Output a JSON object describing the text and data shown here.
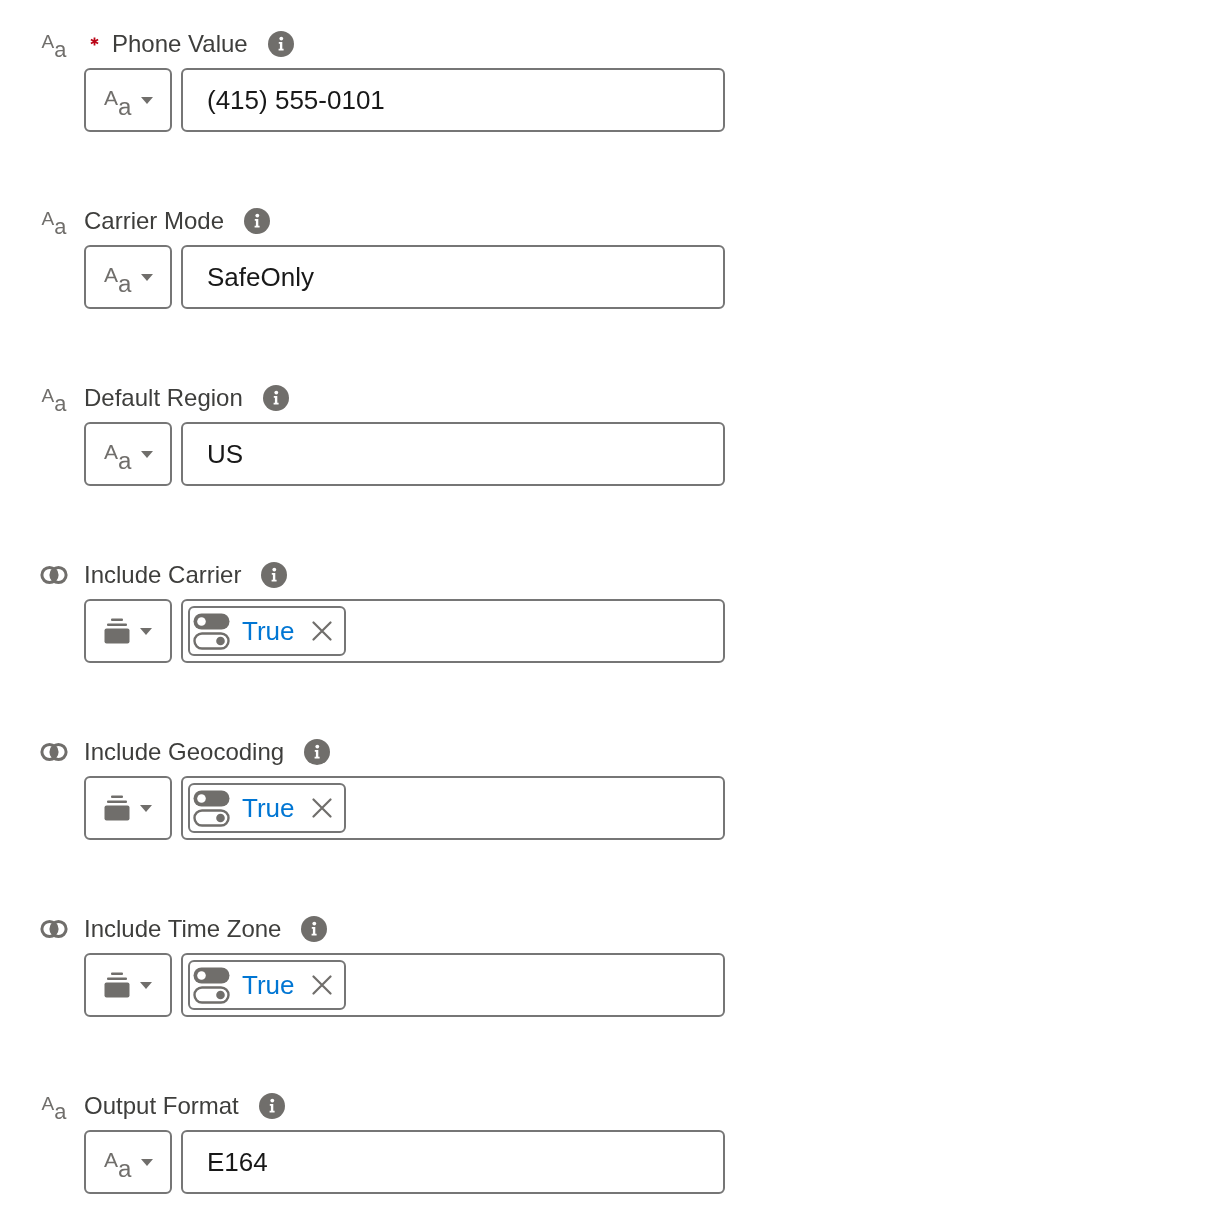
{
  "fields": [
    {
      "kind": "text",
      "type_glyph": "A$_{a}$",
      "required": true,
      "label": "Phone Value",
      "picker_glyph": "A$_{a}$",
      "value": "(415) 555-0101"
    },
    {
      "kind": "text",
      "type_glyph": "A$_{a}$",
      "required": false,
      "label": "Carrier Mode",
      "picker_glyph": "A$_{a}$",
      "value": "SafeOnly"
    },
    {
      "kind": "text",
      "type_glyph": "A$_{a}$",
      "required": false,
      "label": "Default Region",
      "picker_glyph": "A$_{a}$",
      "value": "US"
    },
    {
      "kind": "boolean",
      "required": false,
      "label": "Include Carrier",
      "value": "True"
    },
    {
      "kind": "boolean",
      "required": false,
      "label": "Include Geocoding",
      "value": "True"
    },
    {
      "kind": "boolean",
      "required": false,
      "label": "Include Time Zone",
      "value": "True"
    },
    {
      "kind": "text",
      "type_glyph": "A$_{a}$",
      "required": false,
      "label": "Output Format",
      "picker_glyph": "A$_{a}$",
      "value": "E164"
    }
  ]
}
